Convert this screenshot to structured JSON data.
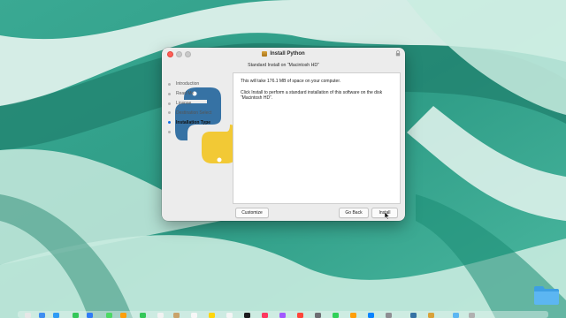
{
  "window": {
    "title": "Install Python",
    "subtitle": "Standard Install on “Macintosh HD”"
  },
  "sidebar": {
    "steps": [
      {
        "label": "Introduction",
        "state": "done"
      },
      {
        "label": "Read Me",
        "state": "done"
      },
      {
        "label": "License",
        "state": "done"
      },
      {
        "label": "Destination Select",
        "state": "done"
      },
      {
        "label": "Installation Type",
        "state": "active"
      },
      {
        "label": "",
        "state": "future"
      }
    ]
  },
  "content": {
    "line1": "This will take 176.1 MB of space on your computer.",
    "line2": "Click Install to perform a standard installation of this software on the disk “Macintosh HD”."
  },
  "buttons": {
    "customize": "Customize",
    "go_back": "Go Back",
    "install": "Install"
  },
  "colors": {
    "active_step": "#1470e6",
    "close_button": "#ff5f57",
    "python_blue": "#3672a4",
    "python_yellow": "#f2c935"
  },
  "icons": [
    "package-icon",
    "lock-icon",
    "python-logo",
    "mouse-cursor-icon",
    "folder-icon"
  ]
}
